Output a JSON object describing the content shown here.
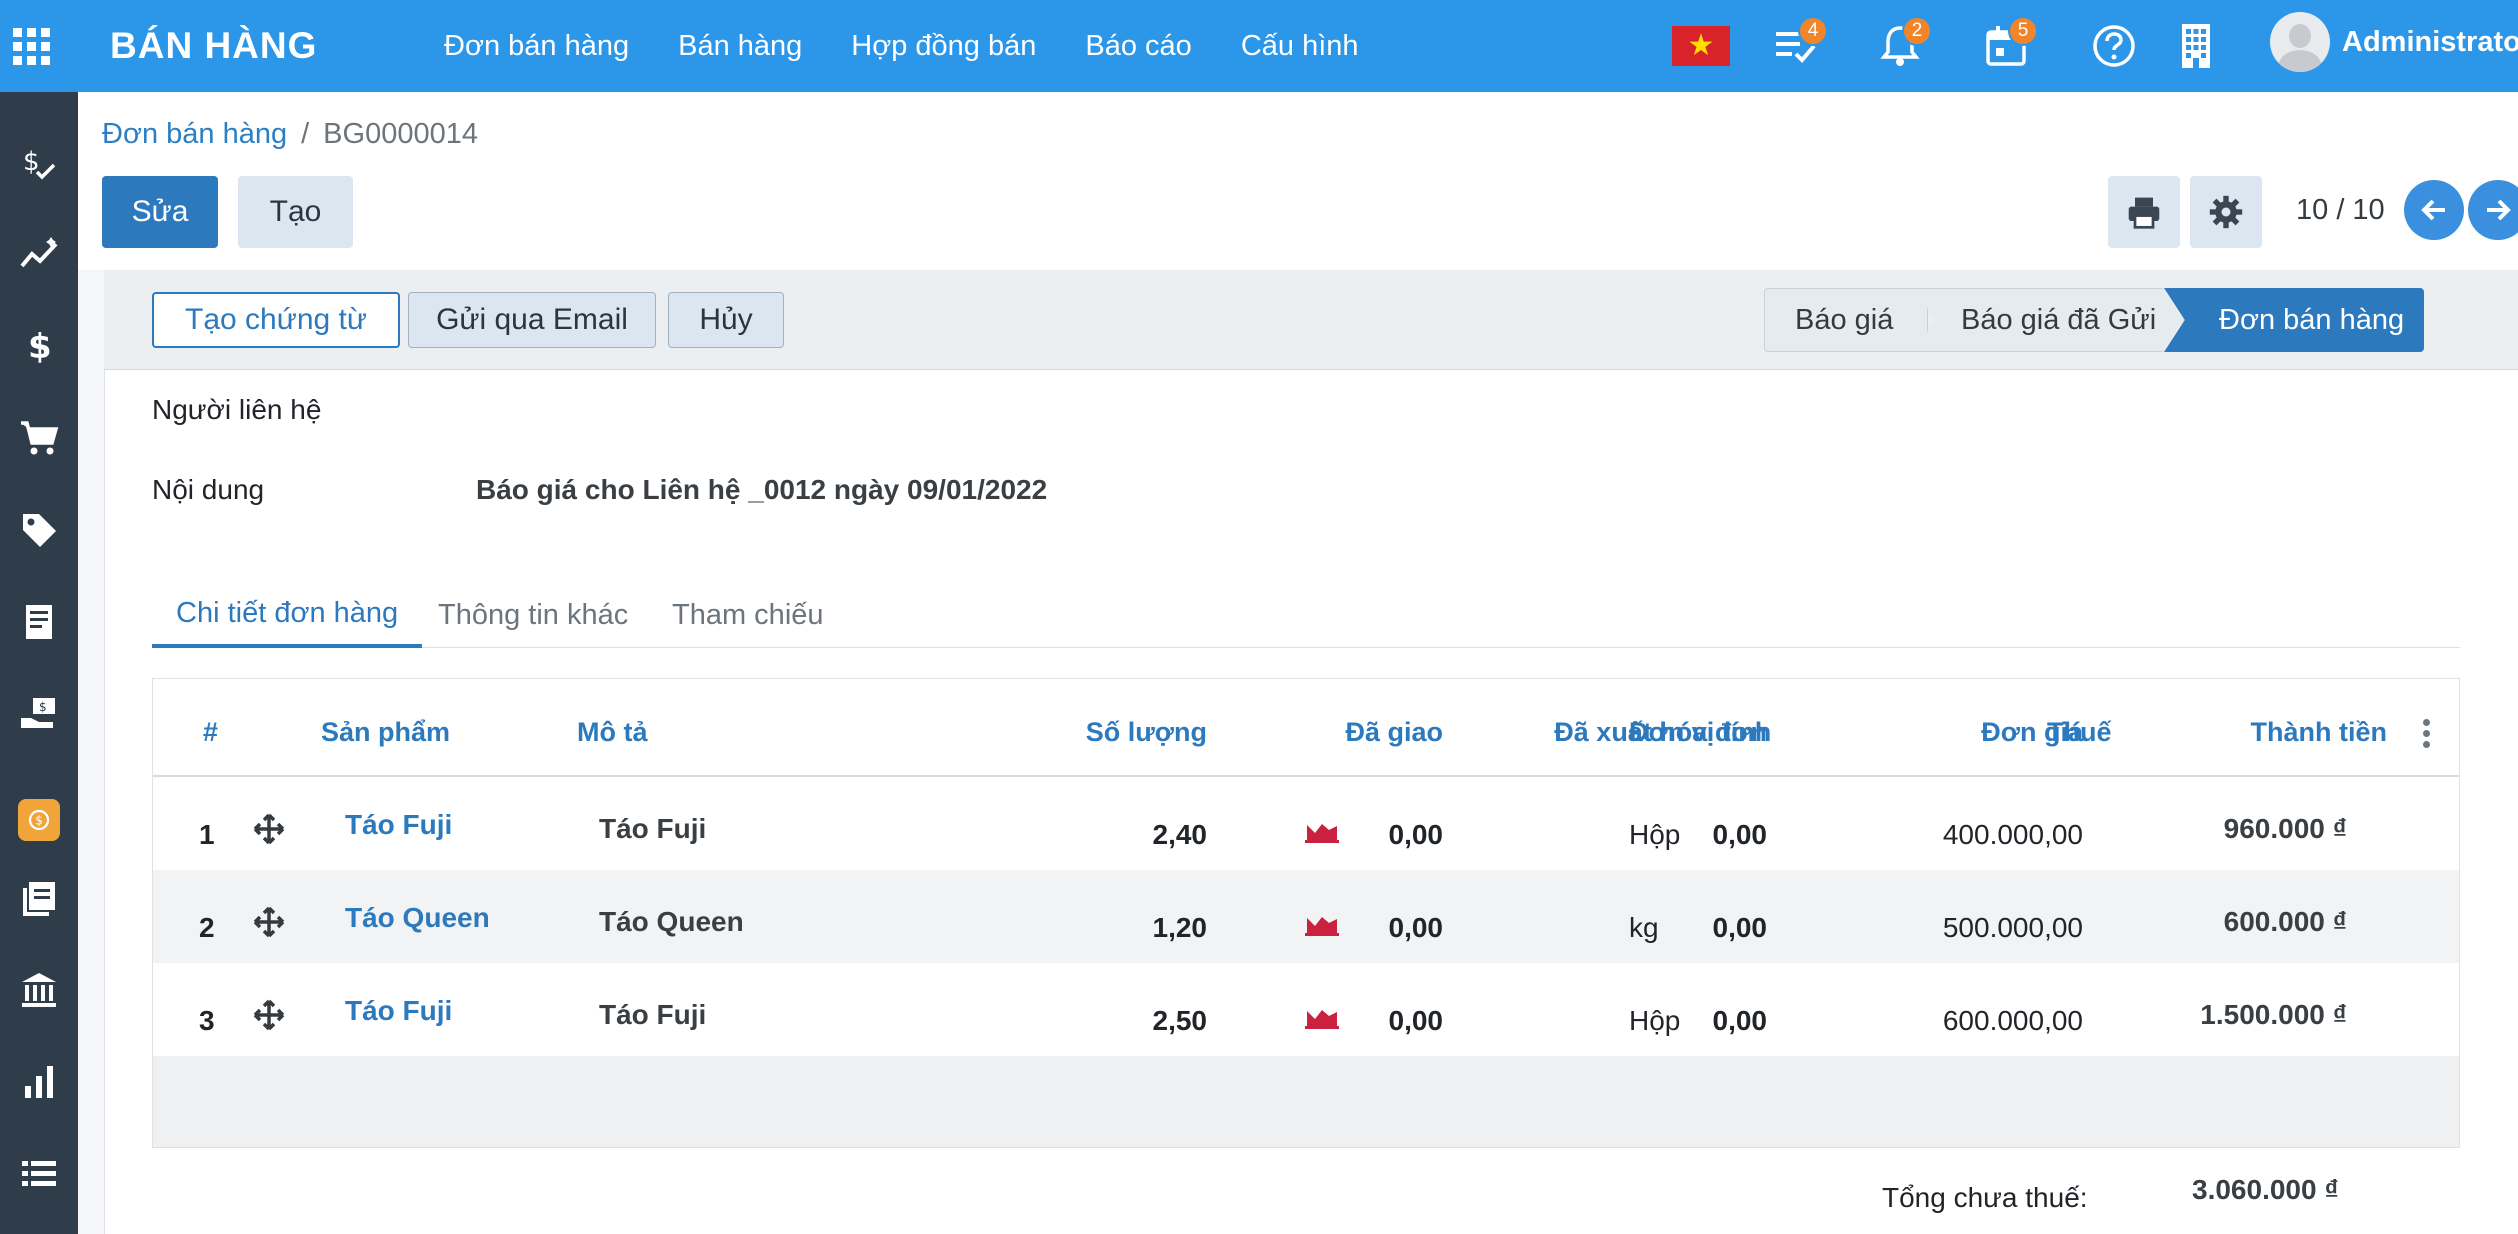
{
  "header": {
    "app_title": "BÁN HÀNG",
    "menu": [
      "Đơn bán hàng",
      "Bán hàng",
      "Hợp đồng bán",
      "Báo cáo",
      "Cấu hình"
    ],
    "badges": {
      "activities": "4",
      "notifications": "2",
      "calendar": "5"
    },
    "user": "Administrator",
    "colors": {
      "topbar": "#2c96e9",
      "badge": "#f0852b"
    }
  },
  "sidebar": {
    "icons": [
      "dollar-check-icon",
      "trend-icon",
      "dollar-icon",
      "cart-icon",
      "tag-icon",
      "receipt-icon",
      "hand-money-icon",
      "app-icon",
      "books-icon",
      "bank-icon",
      "bar-chart-icon",
      "list-icon"
    ]
  },
  "breadcrumb": {
    "parent": "Đơn bán hàng",
    "separator": "/",
    "current": "BG0000014"
  },
  "toolbar": {
    "edit": "Sửa",
    "create": "Tạo"
  },
  "pager": {
    "text": "10 / 10"
  },
  "statusbar": {
    "buttons": {
      "create_doc": "Tạo chứng từ",
      "send_email": "Gửi qua Email",
      "cancel": "Hủy"
    },
    "stages": [
      "Báo giá",
      "Báo giá đã Gửi",
      "Đơn bán hàng"
    ],
    "active_stage": "Đơn bán hàng"
  },
  "form": {
    "contact_label": "Người liên hệ",
    "content_label": "Nội dung",
    "content_value": "Báo giá cho Liên hệ _0012 ngày 09/01/2022"
  },
  "tabs": [
    "Chi tiết đơn hàng",
    "Thông tin khác",
    "Tham chiếu"
  ],
  "table": {
    "columns": {
      "num": "#",
      "product": "Sản phẩm",
      "desc": "Mô tả",
      "qty": "Số lượng",
      "delivered": "Đã giao",
      "invoiced": "Đã xuất hóa đơn",
      "uom": "Đơn vị tính",
      "price": "Đơn giá",
      "tax": "Thuế",
      "subtotal": "Thành tiền"
    },
    "rows": [
      {
        "num": "1",
        "product": "Táo Fuji",
        "desc": "Táo Fuji",
        "qty": "2,40",
        "delivered": "0,00",
        "invoiced": "0,00",
        "uom": "Hộp",
        "price": "400.000,00",
        "subtotal": "960.000 ₫"
      },
      {
        "num": "2",
        "product": "Táo Queen",
        "desc": "Táo Queen",
        "qty": "1,20",
        "delivered": "0,00",
        "invoiced": "0,00",
        "uom": "kg",
        "price": "500.000,00",
        "subtotal": "600.000 ₫"
      },
      {
        "num": "3",
        "product": "Táo Fuji",
        "desc": "Táo Fuji",
        "qty": "2,50",
        "delivered": "0,00",
        "invoiced": "0,00",
        "uom": "Hộp",
        "price": "600.000,00",
        "subtotal": "1.500.000 ₫"
      }
    ]
  },
  "totals": {
    "untaxed_label": "Tổng chưa thuế:",
    "untaxed_value": "3.060.000 ₫"
  }
}
